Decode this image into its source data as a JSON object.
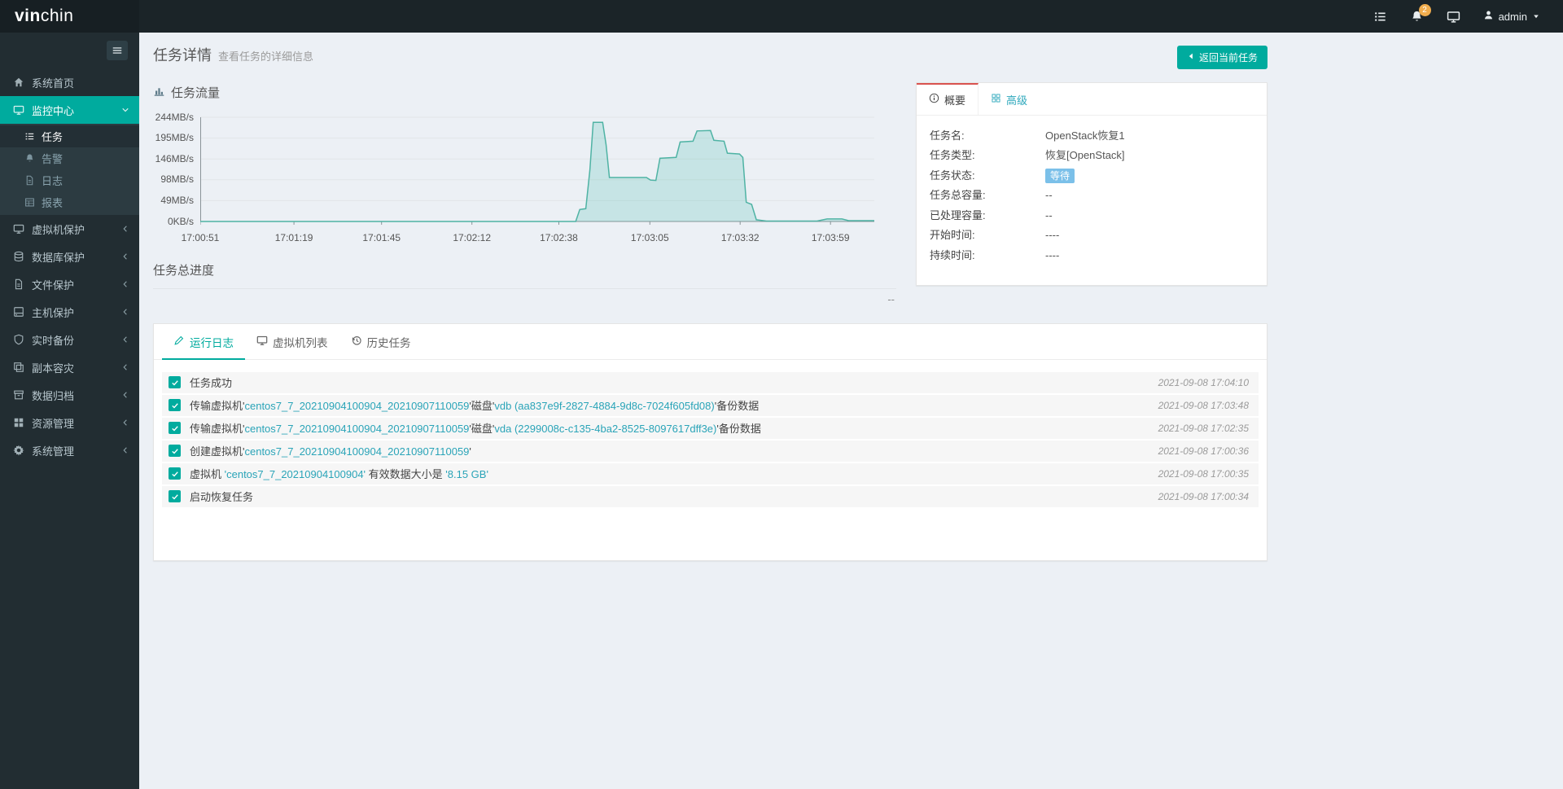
{
  "colors": {
    "accent": "#00ab9e",
    "highlight": "#2aa4b8",
    "badge_waiting": "#7bc0e9",
    "summary_tab_top": "#d9534f",
    "tab_link": "#2ea8bc"
  },
  "topbar": {
    "logo_bold": "vin",
    "logo_light": "chin",
    "badge_count": "2",
    "user": "admin"
  },
  "sidebar": {
    "items": [
      {
        "id": "system-home",
        "label": "系统首页",
        "icon": "home"
      },
      {
        "id": "monitor-center",
        "label": "监控中心",
        "icon": "monitor",
        "active": true,
        "chevron": "down",
        "children": [
          {
            "id": "tasks",
            "label": "任务",
            "icon": "list",
            "active": true
          },
          {
            "id": "alerts",
            "label": "告警",
            "icon": "bell"
          },
          {
            "id": "logs",
            "label": "日志",
            "icon": "file"
          },
          {
            "id": "reports",
            "label": "报表",
            "icon": "report"
          }
        ]
      },
      {
        "id": "vm-protection",
        "label": "虚拟机保护",
        "icon": "monitor",
        "chevron": "left"
      },
      {
        "id": "database-protection",
        "label": "数据库保护",
        "icon": "database",
        "chevron": "left"
      },
      {
        "id": "file-protection",
        "label": "文件保护",
        "icon": "file",
        "chevron": "left"
      },
      {
        "id": "host-protection",
        "label": "主机保护",
        "icon": "host",
        "chevron": "left"
      },
      {
        "id": "realtime-backup",
        "label": "实时备份",
        "icon": "shield",
        "chevron": "left"
      },
      {
        "id": "copy-disaster-recovery",
        "label": "副本容灾",
        "icon": "copy",
        "chevron": "left"
      },
      {
        "id": "data-archive",
        "label": "数据归档",
        "icon": "archive",
        "chevron": "left"
      },
      {
        "id": "resource-management",
        "label": "资源管理",
        "icon": "grid",
        "chevron": "left"
      },
      {
        "id": "system-management",
        "label": "系统管理",
        "icon": "gear",
        "chevron": "left"
      }
    ]
  },
  "header": {
    "title": "任务详情",
    "subtitle": "查看任务的详细信息",
    "back_button": "返回当前任务"
  },
  "chart_data": {
    "type": "area",
    "title": "任务流量",
    "ylabel_ticks": [
      "244MB/s",
      "195MB/s",
      "146MB/s",
      "98MB/s",
      "49MB/s",
      "0KB/s"
    ],
    "y_max": 244,
    "x_ticks": [
      "17:00:51",
      "17:01:19",
      "17:01:45",
      "17:02:12",
      "17:02:38",
      "17:03:05",
      "17:03:32",
      "17:03:59"
    ],
    "x_tick_fractions": [
      0,
      0.139,
      0.269,
      0.403,
      0.532,
      0.667,
      0.801,
      0.935
    ],
    "grid": true,
    "legend": false,
    "series": [
      {
        "name": "任务流量 (MB/s)",
        "points": [
          [
            0,
            0
          ],
          [
            0.55,
            0
          ],
          [
            0.557,
            0
          ],
          [
            0.563,
            28
          ],
          [
            0.572,
            30
          ],
          [
            0.578,
            120
          ],
          [
            0.583,
            232
          ],
          [
            0.597,
            232
          ],
          [
            0.602,
            180
          ],
          [
            0.607,
            103
          ],
          [
            0.662,
            103
          ],
          [
            0.668,
            97
          ],
          [
            0.676,
            96
          ],
          [
            0.682,
            148
          ],
          [
            0.706,
            150
          ],
          [
            0.712,
            186
          ],
          [
            0.731,
            188
          ],
          [
            0.737,
            212
          ],
          [
            0.757,
            213
          ],
          [
            0.762,
            190
          ],
          [
            0.777,
            188
          ],
          [
            0.782,
            160
          ],
          [
            0.8,
            158
          ],
          [
            0.805,
            150
          ],
          [
            0.81,
            45
          ],
          [
            0.818,
            40
          ],
          [
            0.825,
            4
          ],
          [
            0.84,
            1
          ],
          [
            0.915,
            1
          ],
          [
            0.93,
            6
          ],
          [
            0.952,
            6
          ],
          [
            0.962,
            2
          ],
          [
            1,
            2
          ]
        ]
      }
    ]
  },
  "progress": {
    "label": "任务总进度",
    "value": "--"
  },
  "summary": {
    "tabs": [
      {
        "id": "overview",
        "label": "概要",
        "icon": "info",
        "active": true
      },
      {
        "id": "advanced",
        "label": "高级",
        "icon": "grid4",
        "active": false
      }
    ],
    "fields": [
      {
        "label": "任务名:",
        "value": "OpenStack恢复1"
      },
      {
        "label": "任务类型:",
        "value": "恢复[OpenStack]"
      },
      {
        "label": "任务状态:",
        "value": "等待",
        "badge": true
      },
      {
        "label": "任务总容量:",
        "value": "--"
      },
      {
        "label": "已处理容量:",
        "value": "--"
      },
      {
        "label": "开始时间:",
        "value": "----"
      },
      {
        "label": "持续时间:",
        "value": "----"
      }
    ]
  },
  "logs": {
    "tabs": [
      {
        "id": "run-log",
        "label": "运行日志",
        "icon": "pencil",
        "active": true
      },
      {
        "id": "vm-list",
        "label": "虚拟机列表",
        "icon": "monitor",
        "active": false
      },
      {
        "id": "history-tasks",
        "label": "历史任务",
        "icon": "history",
        "active": false
      }
    ],
    "rows": [
      {
        "time": "2021-09-08 17:04:10",
        "segments": [
          {
            "text": "任务成功"
          }
        ]
      },
      {
        "time": "2021-09-08 17:03:48",
        "segments": [
          {
            "text": "传输虚拟机'"
          },
          {
            "text": "centos7_7_20210904100904_20210907110059",
            "highlight": true
          },
          {
            "text": "'磁盘'"
          },
          {
            "text": "vdb (aa837e9f-2827-4884-9d8c-7024f605fd08)",
            "highlight": true
          },
          {
            "text": "'备份数据"
          }
        ]
      },
      {
        "time": "2021-09-08 17:02:35",
        "segments": [
          {
            "text": "传输虚拟机'"
          },
          {
            "text": "centos7_7_20210904100904_20210907110059",
            "highlight": true
          },
          {
            "text": "'磁盘'"
          },
          {
            "text": "vda (2299008c-c135-4ba2-8525-8097617dff3e)",
            "highlight": true
          },
          {
            "text": "'备份数据"
          }
        ]
      },
      {
        "time": "2021-09-08 17:00:36",
        "segments": [
          {
            "text": "创建虚拟机'"
          },
          {
            "text": "centos7_7_20210904100904_20210907110059",
            "highlight": true
          },
          {
            "text": "'"
          }
        ]
      },
      {
        "time": "2021-09-08 17:00:35",
        "segments": [
          {
            "text": "虚拟机 "
          },
          {
            "text": "'centos7_7_20210904100904'",
            "highlight": true
          },
          {
            "text": " 有效数据大小是 "
          },
          {
            "text": "'8.15 GB'",
            "highlight": true
          }
        ]
      },
      {
        "time": "2021-09-08 17:00:34",
        "segments": [
          {
            "text": "启动恢复任务"
          }
        ]
      }
    ]
  }
}
